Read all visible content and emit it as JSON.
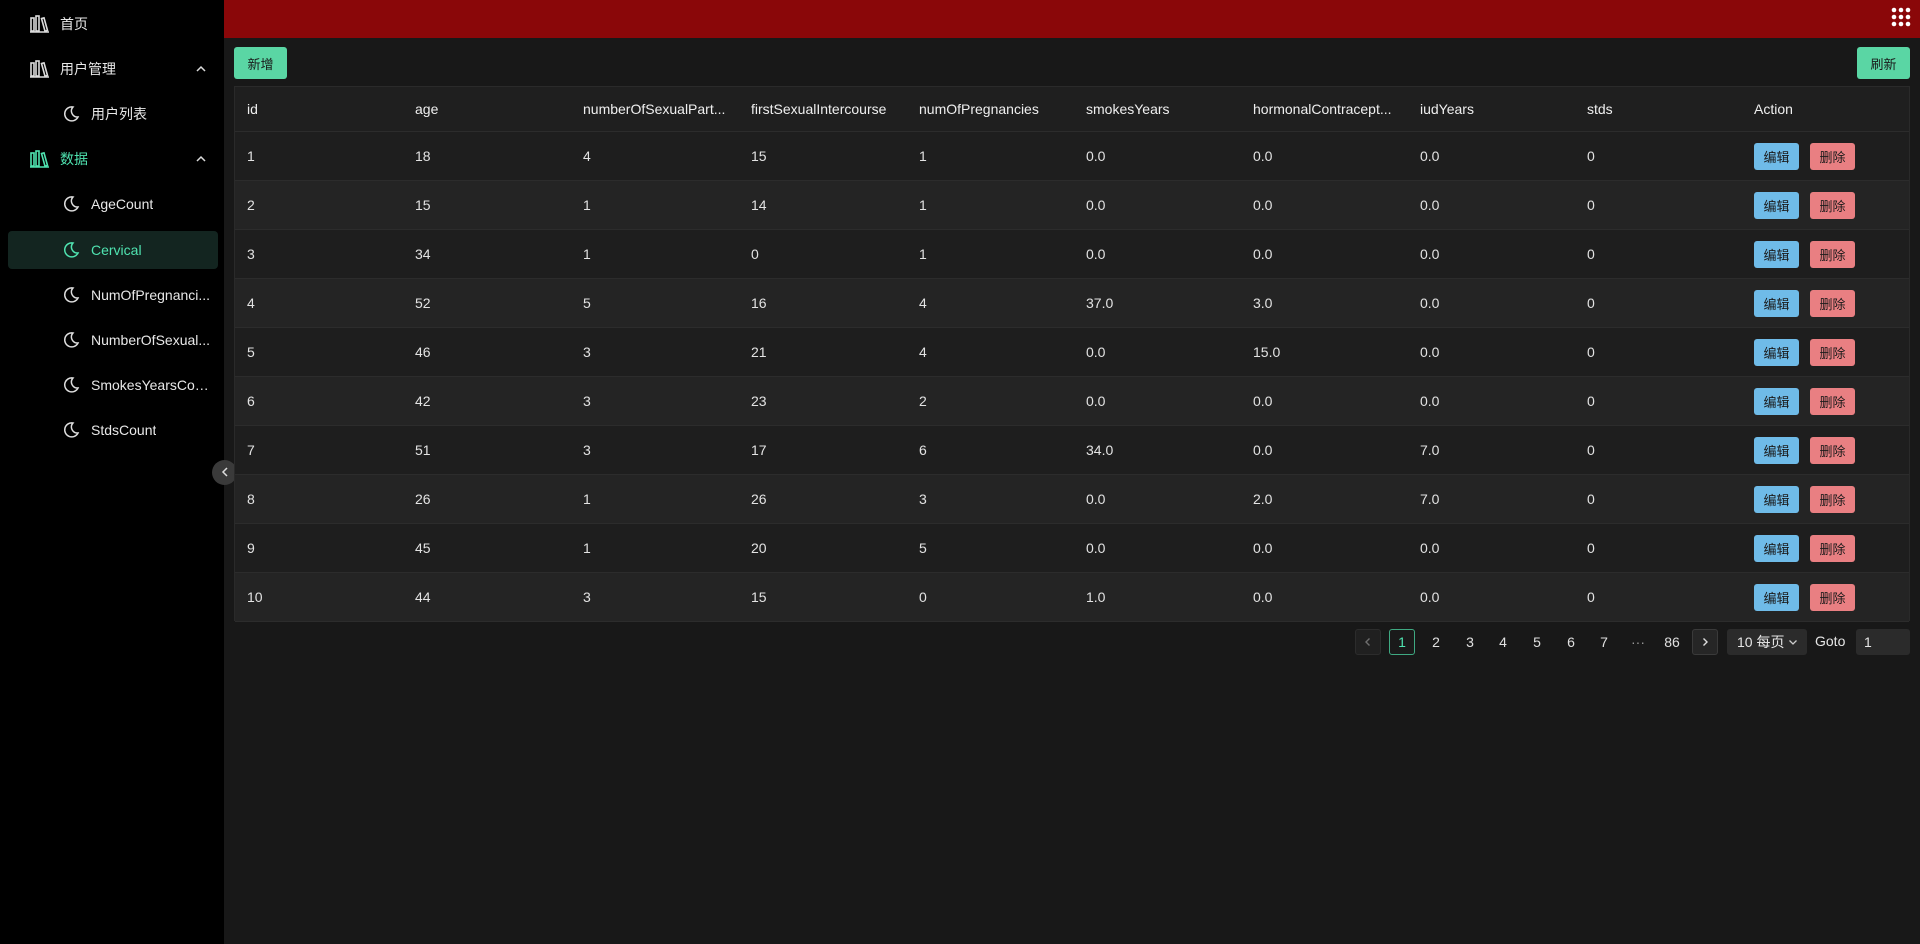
{
  "sidebar": {
    "items": [
      {
        "label": "首页",
        "icon": "library-icon"
      },
      {
        "label": "用户管理",
        "icon": "library-icon"
      },
      {
        "label": "用户列表",
        "icon": "moon-icon"
      },
      {
        "label": "数据",
        "icon": "library-icon"
      },
      {
        "label": "AgeCount",
        "icon": "moon-icon"
      },
      {
        "label": "Cervical",
        "icon": "moon-icon"
      },
      {
        "label": "NumOfPregnanci...",
        "icon": "moon-icon"
      },
      {
        "label": "NumberOfSexual...",
        "icon": "moon-icon"
      },
      {
        "label": "SmokesYearsCou...",
        "icon": "moon-icon"
      },
      {
        "label": "StdsCount",
        "icon": "moon-icon"
      }
    ]
  },
  "toolbar": {
    "add_label": "新增",
    "refresh_label": "刷新"
  },
  "table": {
    "columns": [
      "id",
      "age",
      "numberOfSexualPart...",
      "firstSexualIntercourse",
      "numOfPregnancies",
      "smokesYears",
      "hormonalContracept...",
      "iudYears",
      "stds",
      "Action"
    ],
    "rows": [
      [
        "1",
        "18",
        "4",
        "15",
        "1",
        "0.0",
        "0.0",
        "0.0",
        "0"
      ],
      [
        "2",
        "15",
        "1",
        "14",
        "1",
        "0.0",
        "0.0",
        "0.0",
        "0"
      ],
      [
        "3",
        "34",
        "1",
        "0",
        "1",
        "0.0",
        "0.0",
        "0.0",
        "0"
      ],
      [
        "4",
        "52",
        "5",
        "16",
        "4",
        "37.0",
        "3.0",
        "0.0",
        "0"
      ],
      [
        "5",
        "46",
        "3",
        "21",
        "4",
        "0.0",
        "15.0",
        "0.0",
        "0"
      ],
      [
        "6",
        "42",
        "3",
        "23",
        "2",
        "0.0",
        "0.0",
        "0.0",
        "0"
      ],
      [
        "7",
        "51",
        "3",
        "17",
        "6",
        "34.0",
        "0.0",
        "7.0",
        "0"
      ],
      [
        "8",
        "26",
        "1",
        "26",
        "3",
        "0.0",
        "2.0",
        "7.0",
        "0"
      ],
      [
        "9",
        "45",
        "1",
        "20",
        "5",
        "0.0",
        "0.0",
        "0.0",
        "0"
      ],
      [
        "10",
        "44",
        "3",
        "15",
        "0",
        "1.0",
        "0.0",
        "0.0",
        "0"
      ]
    ],
    "edit_label": "编辑",
    "delete_label": "删除"
  },
  "pagination": {
    "pages": [
      "1",
      "2",
      "3",
      "4",
      "5",
      "6",
      "7",
      "···",
      "86"
    ],
    "current": "1",
    "page_size": "10 每页",
    "goto_label": "Goto",
    "goto_value": "1"
  },
  "colors": {
    "header_bg": "#8a0709",
    "accent": "#4fe3b0",
    "edit": "#6fbbe8",
    "delete": "#e97f82"
  }
}
